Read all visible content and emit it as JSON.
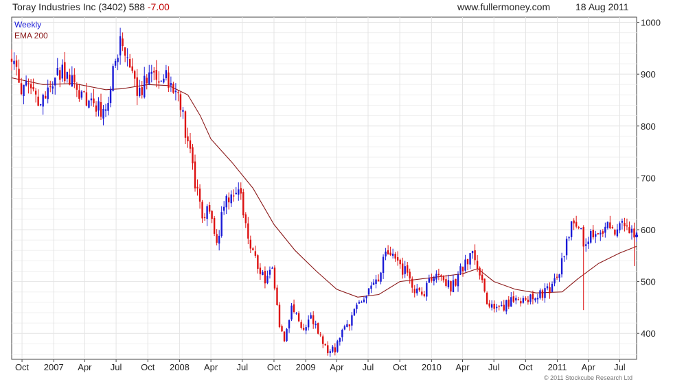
{
  "header": {
    "title": "Toray Industries Inc (3402) 588",
    "change": "-7.00",
    "website": "www.fullermoney.com",
    "date": "18 Aug 2011"
  },
  "legend": {
    "period": "Weekly",
    "ema": "EMA 200"
  },
  "footer": {
    "copyright": "© 2011 Stockcube Research Ltd"
  },
  "colors": {
    "up": "#1a1ad6",
    "down": "#dd1111",
    "ema": "#8b1a1a",
    "grid": "#e4e4e4",
    "frame": "#444444"
  },
  "chart_data": {
    "type": "candlestick",
    "period": "weekly",
    "x_range": [
      "2006-09-01",
      "2011-08-19"
    ],
    "ylim": [
      350,
      1010
    ],
    "y_ticks": [
      400,
      500,
      600,
      700,
      800,
      900,
      1000
    ],
    "x_ticks": [
      {
        "date": "2006-10-01",
        "label": "Oct"
      },
      {
        "date": "2007-01-01",
        "label": "2007"
      },
      {
        "date": "2007-04-01",
        "label": "Apr"
      },
      {
        "date": "2007-07-01",
        "label": "Jul"
      },
      {
        "date": "2007-10-01",
        "label": "Oct"
      },
      {
        "date": "2008-01-01",
        "label": "2008"
      },
      {
        "date": "2008-04-01",
        "label": "Apr"
      },
      {
        "date": "2008-07-01",
        "label": "Jul"
      },
      {
        "date": "2008-10-01",
        "label": "Oct"
      },
      {
        "date": "2009-01-01",
        "label": "2009"
      },
      {
        "date": "2009-04-01",
        "label": "Apr"
      },
      {
        "date": "2009-07-01",
        "label": "Jul"
      },
      {
        "date": "2009-10-01",
        "label": "Oct"
      },
      {
        "date": "2010-01-01",
        "label": "2010"
      },
      {
        "date": "2010-04-01",
        "label": "Apr"
      },
      {
        "date": "2010-07-01",
        "label": "Jul"
      },
      {
        "date": "2010-10-01",
        "label": "Oct"
      },
      {
        "date": "2011-01-01",
        "label": "2011"
      },
      {
        "date": "2011-04-01",
        "label": "Apr"
      },
      {
        "date": "2011-07-01",
        "label": "Jul"
      }
    ],
    "grid": true,
    "close_path": [
      [
        "2006-09-01",
        935
      ],
      [
        "2006-09-22",
        880
      ],
      [
        "2006-10-20",
        865
      ],
      [
        "2006-11-24",
        845
      ],
      [
        "2006-12-22",
        880
      ],
      [
        "2007-01-26",
        910
      ],
      [
        "2007-02-23",
        880
      ],
      [
        "2007-03-23",
        862
      ],
      [
        "2007-04-20",
        850
      ],
      [
        "2007-05-18",
        825
      ],
      [
        "2007-06-08",
        860
      ],
      [
        "2007-06-29",
        915
      ],
      [
        "2007-07-13",
        965
      ],
      [
        "2007-07-27",
        930
      ],
      [
        "2007-08-24",
        875
      ],
      [
        "2007-09-21",
        880
      ],
      [
        "2007-10-12",
        910
      ],
      [
        "2007-11-02",
        880
      ],
      [
        "2007-11-23",
        905
      ],
      [
        "2007-12-14",
        860
      ],
      [
        "2007-12-28",
        870
      ],
      [
        "2008-01-11",
        815
      ],
      [
        "2008-01-25",
        775
      ],
      [
        "2008-02-15",
        690
      ],
      [
        "2008-03-07",
        615
      ],
      [
        "2008-03-28",
        640
      ],
      [
        "2008-04-18",
        575
      ],
      [
        "2008-05-09",
        650
      ],
      [
        "2008-05-30",
        665
      ],
      [
        "2008-06-20",
        680
      ],
      [
        "2008-07-04",
        640
      ],
      [
        "2008-07-25",
        570
      ],
      [
        "2008-08-15",
        530
      ],
      [
        "2008-09-05",
        505
      ],
      [
        "2008-09-26",
        520
      ],
      [
        "2008-10-17",
        420
      ],
      [
        "2008-10-31",
        390
      ],
      [
        "2008-11-21",
        450
      ],
      [
        "2008-12-19",
        410
      ],
      [
        "2009-01-16",
        430
      ],
      [
        "2009-02-13",
        395
      ],
      [
        "2009-03-06",
        360
      ],
      [
        "2009-03-27",
        370
      ],
      [
        "2009-04-17",
        400
      ],
      [
        "2009-05-08",
        420
      ],
      [
        "2009-05-29",
        455
      ],
      [
        "2009-06-19",
        470
      ],
      [
        "2009-07-10",
        490
      ],
      [
        "2009-07-31",
        500
      ],
      [
        "2009-08-21",
        555
      ],
      [
        "2009-09-11",
        545
      ],
      [
        "2009-10-02",
        525
      ],
      [
        "2009-10-23",
        520
      ],
      [
        "2009-11-13",
        480
      ],
      [
        "2009-12-04",
        470
      ],
      [
        "2009-12-25",
        500
      ],
      [
        "2010-01-15",
        515
      ],
      [
        "2010-02-05",
        505
      ],
      [
        "2010-02-26",
        490
      ],
      [
        "2010-03-19",
        510
      ],
      [
        "2010-04-09",
        540
      ],
      [
        "2010-04-30",
        550
      ],
      [
        "2010-05-21",
        515
      ],
      [
        "2010-06-11",
        465
      ],
      [
        "2010-07-02",
        440
      ],
      [
        "2010-07-23",
        445
      ],
      [
        "2010-08-13",
        460
      ],
      [
        "2010-09-03",
        470
      ],
      [
        "2010-10-01",
        465
      ],
      [
        "2010-10-29",
        470
      ],
      [
        "2010-11-19",
        475
      ],
      [
        "2010-12-10",
        485
      ],
      [
        "2011-01-07",
        520
      ],
      [
        "2011-01-28",
        575
      ],
      [
        "2011-02-18",
        620
      ],
      [
        "2011-03-04",
        600
      ],
      [
        "2011-03-18",
        580
      ],
      [
        "2011-04-08",
        590
      ],
      [
        "2011-04-29",
        600
      ],
      [
        "2011-05-20",
        605
      ],
      [
        "2011-06-10",
        595
      ],
      [
        "2011-07-01",
        610
      ],
      [
        "2011-07-22",
        605
      ],
      [
        "2011-08-05",
        595
      ],
      [
        "2011-08-19",
        588
      ]
    ],
    "spikes": [
      {
        "date": "2011-03-18",
        "low": 445
      },
      {
        "date": "2011-08-12",
        "low": 530
      }
    ],
    "ema_series": {
      "name": "EMA 200",
      "points": [
        [
          "2006-09-01",
          893
        ],
        [
          "2006-12-01",
          880
        ],
        [
          "2007-03-01",
          882
        ],
        [
          "2007-06-01",
          870
        ],
        [
          "2007-07-20",
          872
        ],
        [
          "2007-10-01",
          880
        ],
        [
          "2007-12-01",
          878
        ],
        [
          "2008-01-25",
          860
        ],
        [
          "2008-03-01",
          820
        ],
        [
          "2008-04-01",
          775
        ],
        [
          "2008-06-01",
          730
        ],
        [
          "2008-08-01",
          680
        ],
        [
          "2008-10-01",
          610
        ],
        [
          "2008-12-01",
          560
        ],
        [
          "2009-02-01",
          520
        ],
        [
          "2009-04-01",
          485
        ],
        [
          "2009-06-01",
          470
        ],
        [
          "2009-08-01",
          475
        ],
        [
          "2009-10-01",
          500
        ],
        [
          "2009-12-01",
          505
        ],
        [
          "2010-02-01",
          510
        ],
        [
          "2010-04-01",
          515
        ],
        [
          "2010-05-15",
          525
        ],
        [
          "2010-07-01",
          500
        ],
        [
          "2010-09-01",
          485
        ],
        [
          "2010-11-01",
          478
        ],
        [
          "2011-01-15",
          480
        ],
        [
          "2011-03-01",
          505
        ],
        [
          "2011-05-01",
          535
        ],
        [
          "2011-07-01",
          555
        ],
        [
          "2011-08-19",
          568
        ]
      ]
    }
  }
}
